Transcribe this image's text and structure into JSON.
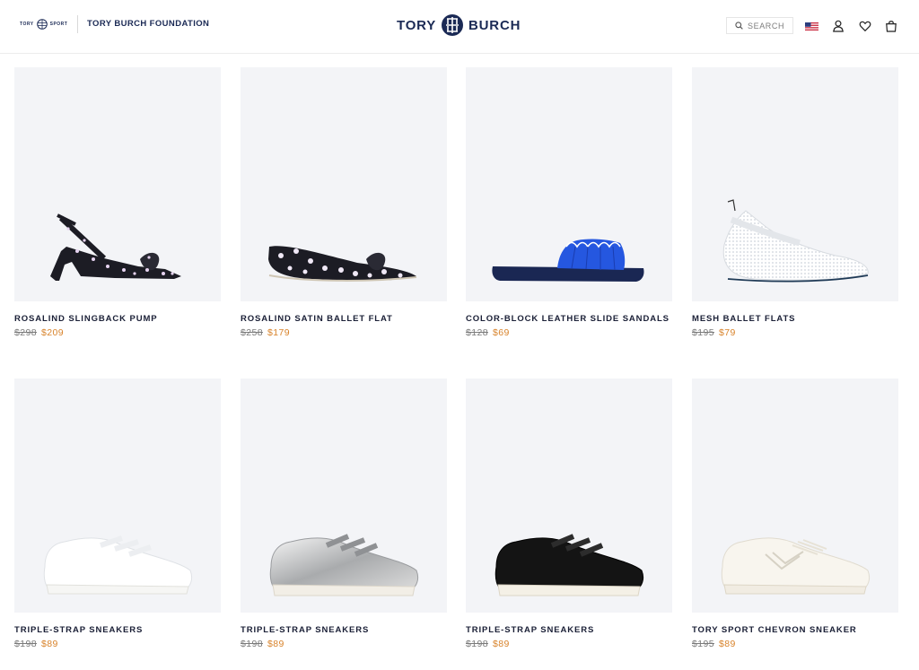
{
  "header": {
    "sport_logo_text_left": "TORY",
    "sport_logo_text_right": "SPORT",
    "foundation_link": "TORY BURCH FOUNDATION",
    "brand_left": "TORY",
    "brand_right": "BURCH",
    "search_label": "SEARCH",
    "icons": [
      "search-icon",
      "us-flag-icon",
      "account-icon",
      "wishlist-heart-icon",
      "shopping-bag-icon"
    ]
  },
  "colors": {
    "brand_navy": "#1b2a55",
    "sale_orange": "#d8832b",
    "tile_background": "#f3f4f7"
  },
  "products": [
    {
      "name": "ROSALIND SLINGBACK PUMP",
      "original_price": "$298",
      "sale_price": "$209"
    },
    {
      "name": "ROSALIND SATIN BALLET FLAT",
      "original_price": "$258",
      "sale_price": "$179"
    },
    {
      "name": "COLOR-BLOCK LEATHER SLIDE SANDALS",
      "original_price": "$128",
      "sale_price": "$69"
    },
    {
      "name": "MESH BALLET FLATS",
      "original_price": "$195",
      "sale_price": "$79"
    },
    {
      "name": "TRIPLE-STRAP SNEAKERS",
      "original_price": "$198",
      "sale_price": "$89"
    },
    {
      "name": "TRIPLE-STRAP SNEAKERS",
      "original_price": "$198",
      "sale_price": "$89"
    },
    {
      "name": "TRIPLE-STRAP SNEAKERS",
      "original_price": "$198",
      "sale_price": "$89"
    },
    {
      "name": "TORY SPORT CHEVRON SNEAKER",
      "original_price": "$195",
      "sale_price": "$89"
    }
  ]
}
